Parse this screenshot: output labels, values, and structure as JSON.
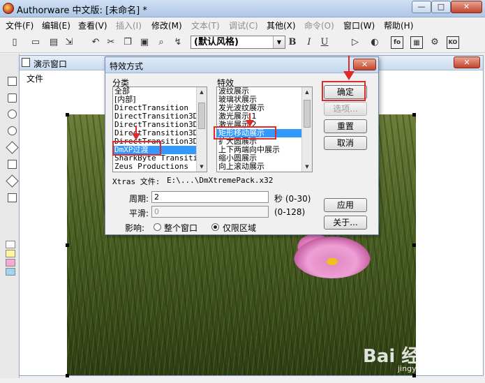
{
  "app": {
    "title": "Authorware 中文版: [未命名] *",
    "caption_buttons": {
      "minimize": "—",
      "maximize": "□",
      "close": "✕"
    }
  },
  "menubar": [
    {
      "label": "文件(F)",
      "enabled": true
    },
    {
      "label": "编辑(E)",
      "enabled": true
    },
    {
      "label": "查看(V)",
      "enabled": true
    },
    {
      "label": "插入(I)",
      "enabled": false
    },
    {
      "label": "修改(M)",
      "enabled": true
    },
    {
      "label": "文本(T)",
      "enabled": false
    },
    {
      "label": "调试(C)",
      "enabled": false
    },
    {
      "label": "其他(X)",
      "enabled": true
    },
    {
      "label": "命令(O)",
      "enabled": false
    },
    {
      "label": "窗口(W)",
      "enabled": true
    },
    {
      "label": "帮助(H)",
      "enabled": true
    }
  ],
  "toolbar": {
    "style_select_value": "(默认风格)",
    "icons": [
      "new-icon",
      "open-icon",
      "save-icon",
      "undo-icon",
      "cut-icon",
      "copy-icon",
      "paste-icon",
      "find-icon",
      "bold-icon",
      "italic-icon",
      "underline-icon",
      "run-icon",
      "control-panel-icon",
      "functions-icon",
      "variables-icon",
      "knowledge-objects-icon"
    ],
    "bold_label": "B",
    "italic_label": "I",
    "underline_label": "U",
    "fn_label": "fo",
    "ko_label": "KO"
  },
  "presentation_window": {
    "title": "演示窗口",
    "menu_label": "文件",
    "close_label": "✕"
  },
  "dialog": {
    "title": "特效方式",
    "close_label": "✕",
    "category_label": "分类",
    "effect_label": "特效",
    "categories": [
      "全部",
      "[内部]",
      "DirectTransition",
      "DirectTransition3D",
      "DirectTransition3D",
      "DirectTransition3D",
      "DirectTransition3D",
      "DmXP过渡",
      "SharkByte Transitio",
      "Zeus Productions"
    ],
    "selected_category": 7,
    "effects": [
      "波纹展示",
      "玻璃状展示",
      "发光波纹展示",
      "激光展示 1",
      "激光展示 2",
      "矩形移动展示",
      "扩大圆展示",
      "上下两端向中展示",
      "缩小圆展示",
      "向上滚动展示"
    ],
    "selected_effect": 5,
    "buttons": {
      "ok": "确定",
      "options": "选项...",
      "reset": "重置",
      "cancel": "取消",
      "apply": "应用",
      "about": "关于..."
    },
    "xtras_label": "Xtras 文件:",
    "xtras_path": "E:\\...\\DmXtremePack.x32",
    "period_label": "周期:",
    "period_value": "2",
    "period_unit": "秒 (0-30)",
    "smooth_label": "平滑:",
    "smooth_value": "0",
    "smooth_range": "(0-128)",
    "affect_label": "影响:",
    "affect_options": [
      {
        "label": "整个窗口",
        "checked": false
      },
      {
        "label": "仅限区域",
        "checked": true
      }
    ]
  },
  "watermark": {
    "text": "Bai 经验",
    "url": "jingyan.baidu.com"
  },
  "colors": {
    "annotation_red": "#e02a2a",
    "selection_blue": "#3399ff"
  }
}
